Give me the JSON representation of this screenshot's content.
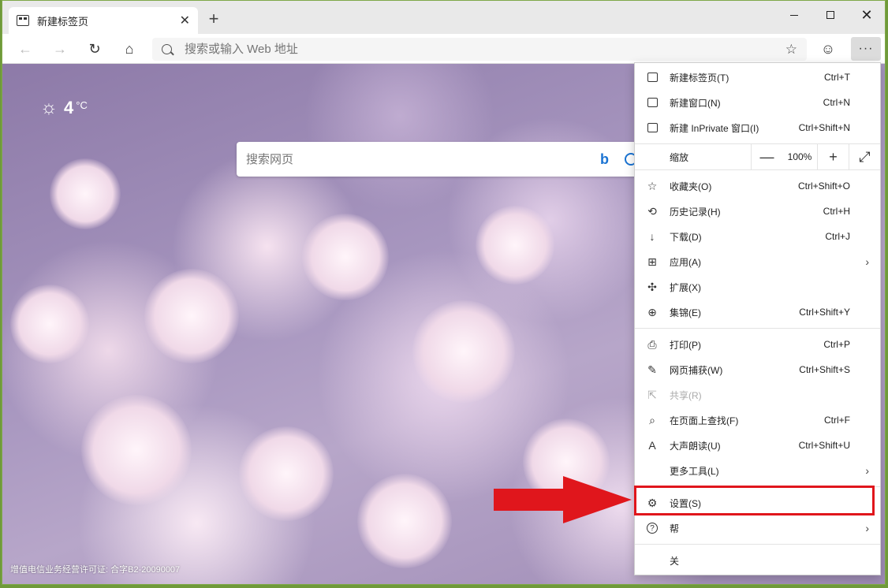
{
  "tab": {
    "title": "新建标签页",
    "close": "✕",
    "new_tab": "+"
  },
  "window_controls": {
    "close": "✕"
  },
  "toolbar": {
    "back": "←",
    "forward": "→",
    "refresh": "↻",
    "home": "⌂",
    "address_placeholder": "搜索或输入 Web 地址",
    "favorite_icon": "☆",
    "profile_icon": "☺",
    "more": "···"
  },
  "page": {
    "weather": {
      "icon": "☼",
      "temp": "4",
      "unit": "°C"
    },
    "search_placeholder": "搜索网页",
    "bing_logo": "b",
    "license": "增值电信业务经营许可证: 合字B2-20090007"
  },
  "menu": {
    "items": [
      {
        "label": "新建标签页(T)",
        "shortcut": "Ctrl+T",
        "icon": "new-tab-icon"
      },
      {
        "label": "新建窗口(N)",
        "shortcut": "Ctrl+N",
        "icon": "new-window-icon"
      },
      {
        "label": "新建 InPrivate 窗口(I)",
        "shortcut": "Ctrl+Shift+N",
        "icon": "inprivate-icon"
      }
    ],
    "zoom": {
      "label": "缩放",
      "minus": "—",
      "value": "100%",
      "plus": "+",
      "fullscreen": "⤢"
    },
    "group2": [
      {
        "label": "收藏夹(O)",
        "shortcut": "Ctrl+Shift+O",
        "icon": "favorites-icon"
      },
      {
        "label": "历史记录(H)",
        "shortcut": "Ctrl+H",
        "icon": "history-icon"
      },
      {
        "label": "下载(D)",
        "shortcut": "Ctrl+J",
        "icon": "download-icon"
      },
      {
        "label": "应用(A)",
        "shortcut": "",
        "icon": "apps-icon",
        "submenu": true
      },
      {
        "label": "扩展(X)",
        "shortcut": "",
        "icon": "extensions-icon"
      },
      {
        "label": "集锦(E)",
        "shortcut": "Ctrl+Shift+Y",
        "icon": "collections-icon"
      }
    ],
    "group3": [
      {
        "label": "打印(P)",
        "shortcut": "Ctrl+P",
        "icon": "print-icon"
      },
      {
        "label": "网页捕获(W)",
        "shortcut": "Ctrl+Shift+S",
        "icon": "web-capture-icon"
      },
      {
        "label": "共享(R)",
        "shortcut": "",
        "icon": "share-icon",
        "disabled": true
      },
      {
        "label": "在页面上查找(F)",
        "shortcut": "Ctrl+F",
        "icon": "find-icon"
      },
      {
        "label": "大声朗读(U)",
        "shortcut": "Ctrl+Shift+U",
        "icon": "read-aloud-icon"
      },
      {
        "label": "更多工具(L)",
        "shortcut": "",
        "icon": "more-tools-icon",
        "submenu": true
      }
    ],
    "settings": {
      "label": "设置(S)",
      "icon": "settings-icon"
    },
    "help": {
      "label": "帮",
      "icon": "help-icon",
      "submenu": true
    },
    "close": {
      "label": "关"
    }
  },
  "icons": {
    "star": "☆",
    "history": "⟲",
    "download": "↓",
    "apps": "⊞",
    "puzzle": "✣",
    "collections": "⊕",
    "print": "⎙",
    "capture": "✎",
    "share": "⇱",
    "find": "⌕",
    "read": "A",
    "gear": "⚙",
    "help": "?",
    "chevron": "›"
  },
  "colors": {
    "highlight": "#e0161c",
    "accent": "#1a73d2"
  }
}
